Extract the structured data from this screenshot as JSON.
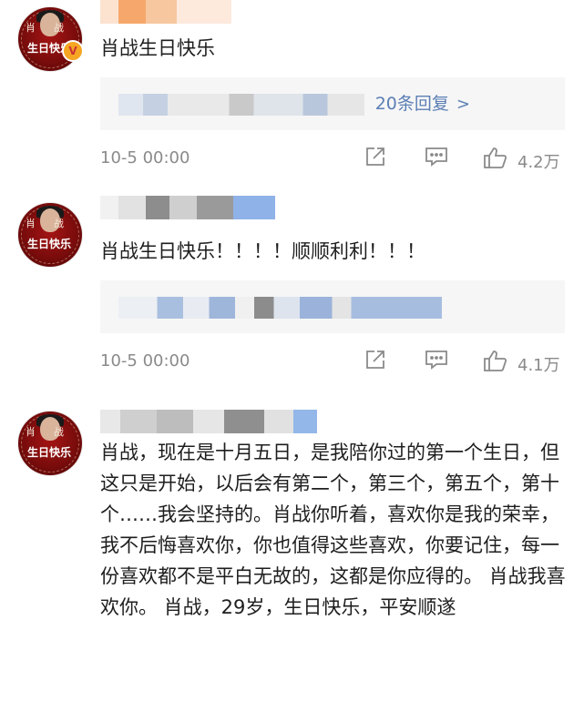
{
  "comments": [
    {
      "avatar_text_1": "肖战",
      "avatar_text_2": "生日快乐",
      "has_vip_badge": true,
      "vip_badge": "V",
      "text": "肖战生日快乐",
      "reply_link": "20条回复",
      "time": "10-5 00:00",
      "likes": "4.2万"
    },
    {
      "avatar_text_1": "肖战",
      "avatar_text_2": "生日快乐",
      "has_vip_badge": false,
      "text": "肖战生日快乐！！！！顺顺利利！！！",
      "time": "10-5 00:00",
      "likes": "4.1万"
    },
    {
      "avatar_text_1": "肖战",
      "avatar_text_2": "生日快乐",
      "has_vip_badge": false,
      "text": "肖战，现在是十月五日，是我陪你过的第一个生日，但这只是开始，以后会有第二个，第三个，第五个，第十个……我会坚持的。肖战你听着，喜欢你是我的荣幸，我不后悔喜欢你，你也值得这些喜欢，你要记住，每一份喜欢都不是平白无故的，这都是你应得的。 肖战我喜欢你。 肖战，29岁，生日快乐，平安顺遂"
    }
  ],
  "icons": {
    "share": "share-icon",
    "comment": "comment-icon",
    "like": "thumbs-up-icon",
    "chevron": "chevron-right-icon"
  },
  "colors": {
    "link": "#5c7fb5",
    "meta": "#8a8a8a",
    "avatar_red": "#a51414",
    "badge": "#f5a623",
    "reply_bg": "#f6f6f6"
  }
}
